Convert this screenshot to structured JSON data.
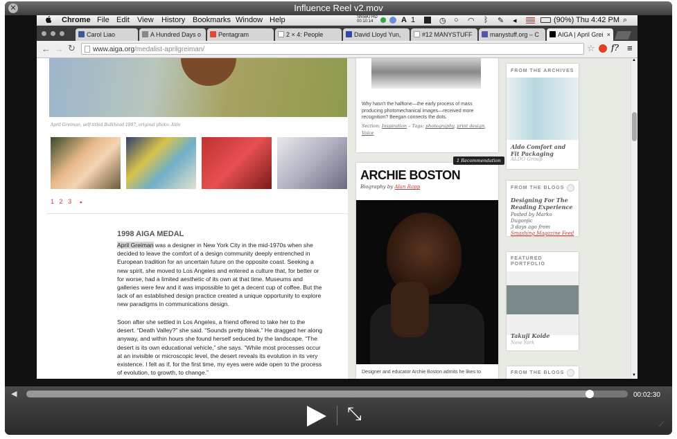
{
  "player": {
    "title": "Influence Reel v2.mov",
    "close_glyph": "✕",
    "elapsed": "00:02:30",
    "progress_fraction": 0.937
  },
  "menubar": {
    "apple": "",
    "app": "Chrome",
    "items": [
      "File",
      "Edit",
      "View",
      "History",
      "Bookmarks",
      "Window",
      "Help"
    ],
    "showuhd": "ShowU HD",
    "rec_time": "00:10:14",
    "ai_count": "1",
    "battery": "(90%)",
    "clock": "Thu 4:42 PM"
  },
  "tabs": [
    {
      "label": "Carol Liao",
      "color": "#3b5998"
    },
    {
      "label": "A Hundred Days o",
      "color": "#777777"
    },
    {
      "label": "Pentagram",
      "color": "#e04a2f"
    },
    {
      "label": "2 × 4: People",
      "color": "#ffffff"
    },
    {
      "label": "David Lloyd Yun,",
      "color": "#3344aa"
    },
    {
      "label": "#12 MANYSTUFF",
      "color": "#ffffff"
    },
    {
      "label": "manystuff.org – C",
      "color": "#5555aa"
    },
    {
      "label": "AIGA | April Grei",
      "color": "#000000"
    }
  ],
  "url": {
    "host": "www.aiga.org",
    "path": "/medalist-aprilgreiman/"
  },
  "article": {
    "caption": "April Greiman, self-titled Bulkhead 1997, original photo: Aldo",
    "pages": [
      "1",
      "2",
      "3"
    ],
    "next_glyph": "▸",
    "heading": "1998 AIGA MEDAL",
    "highlight": "April Greiman",
    "para1_rest": " was a designer in New York City in the mid-1970s when she decided to leave the comfort of a design community deeply entrenched in European tradition for an uncertain future on the opposite coast. Seeking a new spirit, she moved to Los Angeles and entered a culture that, for better or for worse, had a limited aesthetic of its own at that time. Museums and galleries were few and it was impossible to get a decent cup of coffee. But the lack of an established design practice created a unique opportunity to explore new paradigms in communications design.",
    "para2": "Soon after she settled in Los Angeles, a friend offered to take her to the desert. “Death Valley?” she said. “Sounds pretty bleak.” He dragged her along anyway, and within hours she found herself seduced by the landscape. “The desert is its own educational vehicle,” she says. “While most processes occur at an invisible or microscopic level, the desert reveals its evolution in its very existence. I felt as if, for the first time, my eyes were wide open to the process of evolution, to growth, to change.”"
  },
  "halftone": {
    "text": "Why hasn't the halftone—the early process of mass producing photomechanical images—received more recognition? Beegan connects the dots.",
    "section_label": "Section:",
    "section": "Inspiration",
    "tags_label": "– Tags:",
    "tags": [
      "photography",
      "print design"
    ],
    "sep": ",",
    "voice": "Voice"
  },
  "boston": {
    "recommend": "1 Recommendation",
    "name": "ARCHIE BOSTON",
    "bio_label": "Biography by",
    "author": "Alan Rapp",
    "caption": "Designer and educator Archie Boston admits he likes to"
  },
  "sidebar": {
    "archives_label": "FROM THE ARCHIVES",
    "archives_title": "Aldo Comfort and Fit Packaging",
    "archives_sub": "ALDO Group",
    "blogs_label": "FROM THE BLOGS",
    "blogs_title": "Designing For The Reading Experience",
    "blogs_by": "Posted by Marko Dugonjic",
    "blogs_when": "3 days ago from",
    "blogs_source": "Smashing Magazine Feed",
    "featured_label": "FEATURED PORTFOLIO",
    "featured_name": "Takuji Koide",
    "featured_city": "New York",
    "blogs2_label": "FROM THE BLOGS"
  }
}
